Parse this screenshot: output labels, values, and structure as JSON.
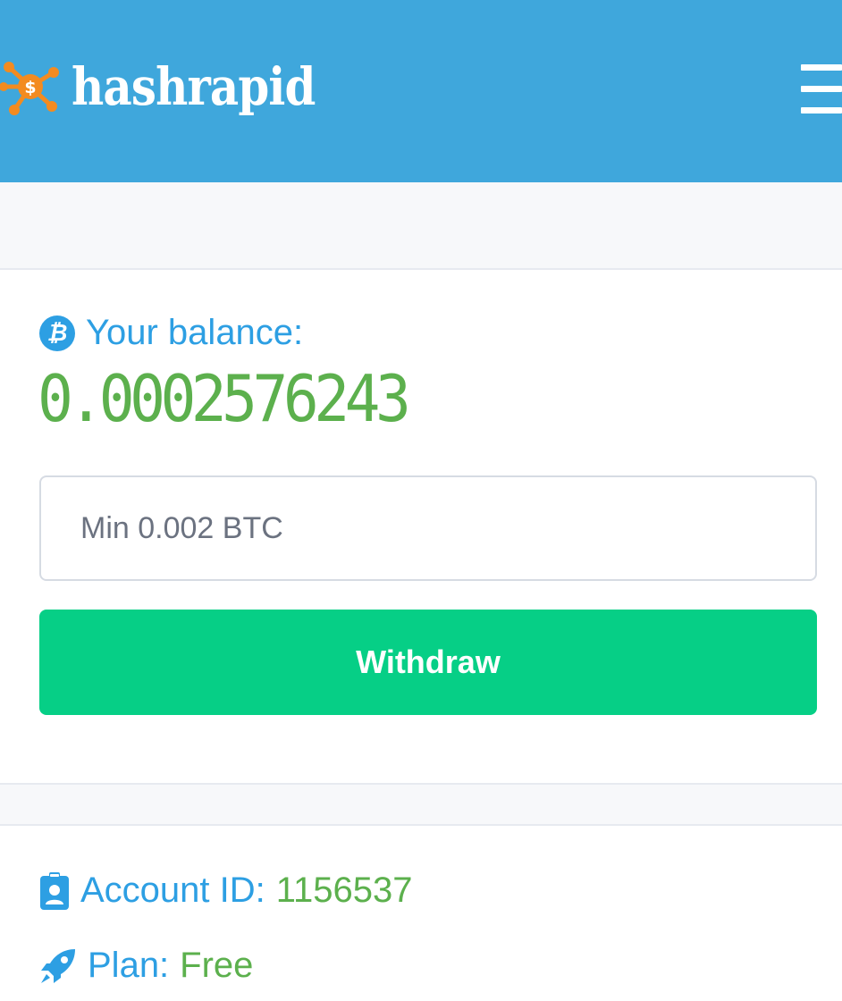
{
  "header": {
    "brand_name": "hashrapid",
    "logo_icon": "network-dollar-icon",
    "menu_icon": "hamburger-menu-icon",
    "background_color": "#3fa7dc",
    "logo_accent_color": "#f38b20"
  },
  "balance": {
    "icon": "bitcoin-icon",
    "label": "Your balance:",
    "value": "0.0002576243",
    "label_color": "#2d9fe3",
    "value_color": "#5cb04d"
  },
  "withdraw_form": {
    "amount_placeholder": "Min 0.002 BTC",
    "amount_value": "",
    "button_label": "Withdraw",
    "button_color": "#06cf86"
  },
  "account": {
    "id_icon": "id-badge-icon",
    "id_label": "Account ID:",
    "id_value": "1156537",
    "plan_icon": "rocket-icon",
    "plan_label": "Plan:",
    "plan_value": "Free"
  }
}
